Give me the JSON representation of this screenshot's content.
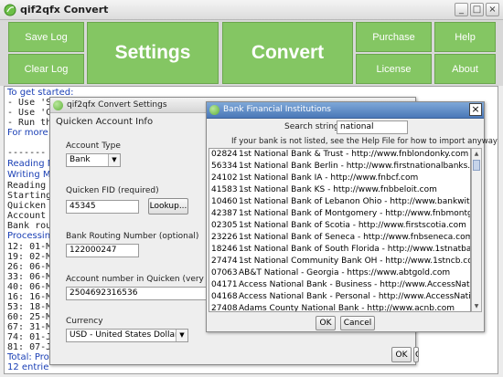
{
  "app": {
    "title": "qif2qfx Convert"
  },
  "toolbar": {
    "save_log": "Save Log",
    "clear_log": "Clear Log",
    "settings": "Settings",
    "convert": "Convert",
    "purchase": "Purchase",
    "license": "License",
    "help": "Help",
    "about": "About"
  },
  "log": {
    "lines": [
      "To get started:",
      "- Use 'S",
      "- Use 'C",
      "- Run th",
      "For more c",
      "",
      "-------",
      "Reading M",
      "Writing M'",
      "Reading",
      "Starting",
      "Quicken",
      "Account",
      "Bank rou",
      "Processing",
      "12: 01-M",
      "19: 02-M",
      "26: 06-M",
      "33: 06-M",
      "40: 06-M",
      "16: 16-M",
      "53: 18-M",
      "60: 25-M",
      "67: 31-M",
      "74: 01-J",
      "81: 07-J",
      "Total: Proc",
      "12 entrie"
    ]
  },
  "settings_dialog": {
    "title": "qif2qfx Convert Settings",
    "section": "Quicken Account Info",
    "account_type_label": "Account Type",
    "account_type_value": "Bank",
    "fid_label": "Quicken FID (required)",
    "fid_value": "45345",
    "lookup_button": "Lookup...",
    "routing_label": "Bank Routing Number (optional)",
    "routing_value": "122000247",
    "account_label": "Account number in Quicken (very useful)",
    "account_value": "2504692316536",
    "currency_label": "Currency",
    "currency_value": "USD - United States Dollar",
    "ok_button": "OK",
    "cancel_button": "Ca"
  },
  "bank_dialog": {
    "title": "Bank Financial Institutions",
    "close": "×",
    "search_label": "Search string:",
    "search_value": "national",
    "hint": "If your bank is not listed, see the Help File for how to import anyway",
    "ok_button": "OK",
    "cancel_button": "Cancel",
    "banks": [
      {
        "code": "02824",
        "name": "1st National Bank & Trust - http://www.fnblondonky.com"
      },
      {
        "code": "56334",
        "name": "1st National Bank Berlin - http://www.firstnationalbanks.biz"
      },
      {
        "code": "24102",
        "name": "1st National Bank IA - http://www.fnbcf.com"
      },
      {
        "code": "41583",
        "name": "1st National Bank KS - http://www.fnbbeloit.com"
      },
      {
        "code": "10460",
        "name": "1st National Bank of Lebanon Ohio - http://www.bankwith1st.com"
      },
      {
        "code": "42387",
        "name": "1st National Bank of Montgomery - http://www.fnbmontgomery.com"
      },
      {
        "code": "02305",
        "name": "1st National Bank of Scotia - http://www.firstscotia.com"
      },
      {
        "code": "23226",
        "name": "1st National Bank of Seneca - http://www.fnbseneca.com"
      },
      {
        "code": "18246",
        "name": "1st National Bank of South Florida - http://www.1stnatbank.com"
      },
      {
        "code": "27474",
        "name": "1st National Community Bank OH - http://www.1stncb.com"
      },
      {
        "code": "07063",
        "name": "AB&T National - Georgia - https://www.abtgold.com"
      },
      {
        "code": "04171",
        "name": "Access National Bank - Business - http://www.AccessNationalBank.c"
      },
      {
        "code": "04168",
        "name": "Access National Bank - Personal - http://www.AccessNationalBank.c"
      },
      {
        "code": "27408",
        "name": "Adams County National Bank - http://www.acnb.com"
      }
    ]
  },
  "colors": {
    "button_green": "#84c663",
    "log_blue": "#1a3fb5",
    "dialog_title_blue": "#4a78b8"
  }
}
